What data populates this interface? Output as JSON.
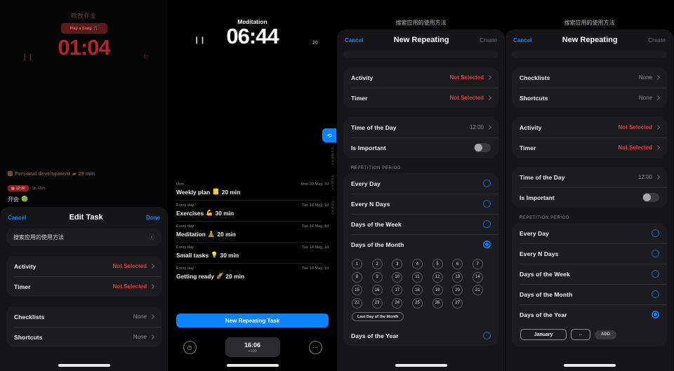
{
  "panel1": {
    "chinese_header": "改改作业",
    "song_button": "Play a Song",
    "song_icon": "music-note-icon",
    "timer_value": "01:04",
    "pause_icon": "pause-icon",
    "reset_icon": "reset-icon",
    "activity_line": "Personal development",
    "activity_duration": "29 min",
    "mini_badge_time": "12:30",
    "mini_badge_dur": "1h 45m",
    "meal_line": "开会",
    "meal_emoji": "🟢",
    "sheet": {
      "cancel": "Cancel",
      "title": "Edit Task",
      "done": "Done",
      "task_name": "搜索应用的使用方法",
      "clear_icon": "clear-circle-icon",
      "rows": [
        {
          "label": "Activity",
          "value": "Not Selected",
          "red": true
        },
        {
          "label": "Timer",
          "value": "Not Selected",
          "red": true
        }
      ],
      "rows2": [
        {
          "label": "Checklists",
          "value": "None",
          "red": false
        },
        {
          "label": "Shortcuts",
          "value": "None",
          "red": false
        }
      ]
    }
  },
  "panel2": {
    "title": "Meditation",
    "timer_value": "06:44",
    "counter": "20",
    "pause_icon": "pause-icon",
    "fab_icon": "repeat-icon",
    "rail": [
      "SUNDAY",
      "TODAY",
      "TODAY"
    ],
    "rail_num": "13\n05",
    "tasks": [
      {
        "repeat": "Mon",
        "due": "Mon 20 May, 7d",
        "title": "Weekly plan",
        "emoji": "📒",
        "duration": "20 min"
      },
      {
        "repeat": "Every day",
        "due": "Tue 14 May, 1d",
        "title": "Exercises",
        "emoji": "💪",
        "duration": "30 min"
      },
      {
        "repeat": "Every day",
        "due": "Tue 14 May, 1d",
        "title": "Meditation",
        "emoji": "🧘",
        "duration": "20 min"
      },
      {
        "repeat": "Every day",
        "due": "Tue 14 May, 1d",
        "title": "Small tasks",
        "emoji": "💡",
        "duration": "30 min"
      },
      {
        "repeat": "Every day",
        "due": "Tue 14 May, 1d",
        "title": "Getting ready",
        "emoji": "🚀",
        "duration": "20 min"
      }
    ],
    "new_task_button": "New Repeating Task",
    "stopwatch_icon": "stopwatch-icon",
    "more_icon": "ellipsis-icon",
    "clock_time": "16:06",
    "clock_sub": "+100"
  },
  "panel3": {
    "bg_title": "搜索应用的使用方法",
    "cancel": "Cancel",
    "title": "New Repeating",
    "create": "Create",
    "rows_a": [
      {
        "label": "Activity",
        "value": "Not Selected",
        "red": true
      },
      {
        "label": "Timer",
        "value": "Not Selected",
        "red": true
      }
    ],
    "rows_b": [
      {
        "label": "Time of the Day",
        "value": "12:00",
        "red": false
      }
    ],
    "toggle_label": "Is Important",
    "section_header": "REPETITION PERIOD",
    "options": [
      {
        "label": "Every Day",
        "selected": false
      },
      {
        "label": "Every N Days",
        "selected": false
      },
      {
        "label": "Days of the Week",
        "selected": false
      },
      {
        "label": "Days of the Month",
        "selected": true
      },
      {
        "label": "Days of the Year",
        "selected": false
      }
    ],
    "days": [
      "1",
      "2",
      "3",
      "4",
      "5",
      "6",
      "7",
      "8",
      "9",
      "10",
      "11",
      "12",
      "13",
      "14",
      "15",
      "16",
      "17",
      "18",
      "19",
      "20",
      "21",
      "22",
      "23",
      "24",
      "25",
      "26",
      "27"
    ],
    "last_day_chip": "Last Day of the Month"
  },
  "panel4": {
    "bg_title": "搜索应用的使用方法",
    "cancel": "Cancel",
    "title": "New Repeating",
    "create": "Create",
    "rows_a": [
      {
        "label": "Checklists",
        "value": "None",
        "red": false
      },
      {
        "label": "Shortcuts",
        "value": "None",
        "red": false
      }
    ],
    "rows_b": [
      {
        "label": "Activity",
        "value": "Not Selected",
        "red": true
      },
      {
        "label": "Timer",
        "value": "Not Selected",
        "red": true
      }
    ],
    "rows_c": [
      {
        "label": "Time of the Day",
        "value": "12:00",
        "red": false
      }
    ],
    "toggle_label": "Is Important",
    "section_header": "REPETITION PERIOD",
    "options": [
      {
        "label": "Every Day",
        "selected": false
      },
      {
        "label": "Every N Days",
        "selected": false
      },
      {
        "label": "Days of the Week",
        "selected": false
      },
      {
        "label": "Days of the Month",
        "selected": false
      },
      {
        "label": "Days of the Year",
        "selected": true
      }
    ],
    "month_value": "January",
    "day_value": "--",
    "add_button": "ADD"
  },
  "colors": {
    "accent_blue": "#0a84ff",
    "danger_red": "#e8383d",
    "panel1_red": "#b82328",
    "card_bg": "#1c1c1e",
    "sheet_bg": "#161618"
  }
}
